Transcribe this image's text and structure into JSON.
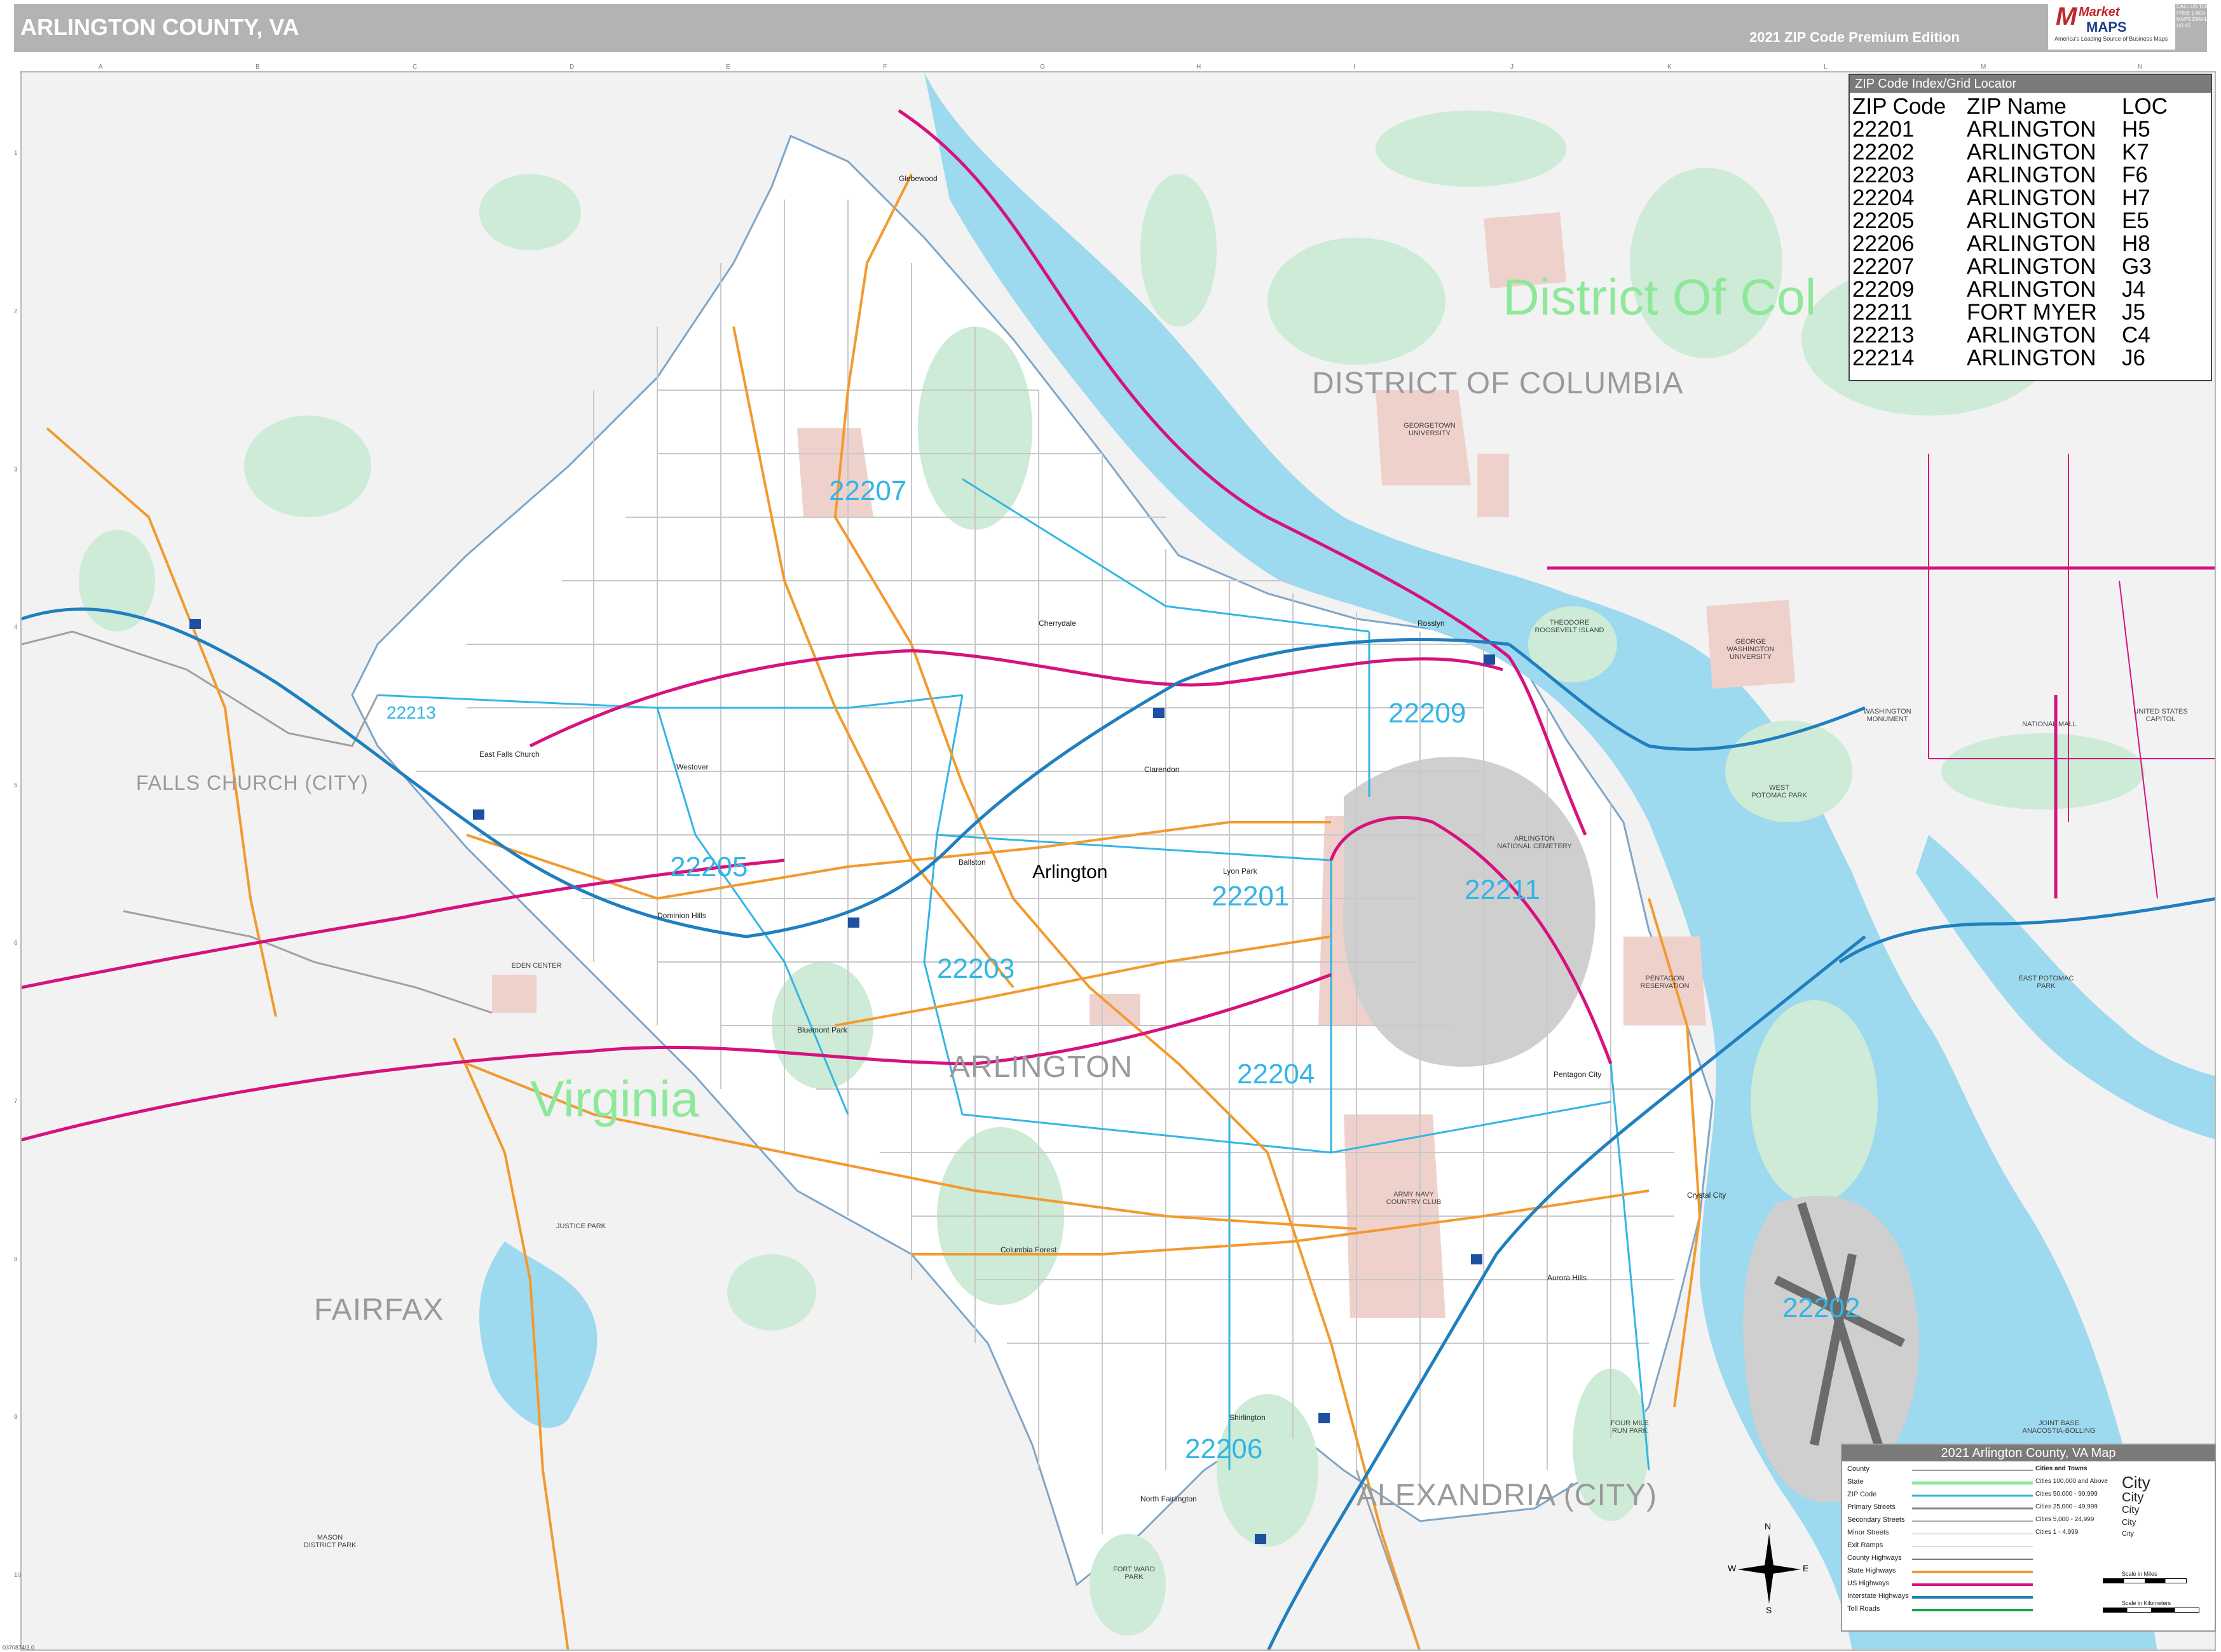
{
  "header": {
    "title": "ARLINGTON COUNTY, VA",
    "edition": "2021 ZIP Code Premium Edition",
    "logo_text_1": "Market",
    "logo_text_2": "MAPS",
    "logo_slogan": "America's Leading Source of Business Maps",
    "logo_contact": "CALL US TOLL FREE 1-800-MAPS EMAIL US AT"
  },
  "grid": {
    "letters": [
      "A",
      "B",
      "C",
      "D",
      "E",
      "F",
      "G",
      "H",
      "I",
      "J",
      "K",
      "L",
      "M",
      "N"
    ],
    "numbers": [
      "1",
      "2",
      "3",
      "4",
      "5",
      "6",
      "7",
      "8",
      "9",
      "10"
    ]
  },
  "zip_index": {
    "title": "ZIP Code Index/Grid Locator",
    "headers": [
      "ZIP Code",
      "ZIP Name",
      "LOC"
    ],
    "rows": [
      [
        "22201",
        "ARLINGTON",
        "H5"
      ],
      [
        "22202",
        "ARLINGTON",
        "K7"
      ],
      [
        "22203",
        "ARLINGTON",
        "F6"
      ],
      [
        "22204",
        "ARLINGTON",
        "H7"
      ],
      [
        "22205",
        "ARLINGTON",
        "E5"
      ],
      [
        "22206",
        "ARLINGTON",
        "H8"
      ],
      [
        "22207",
        "ARLINGTON",
        "G3"
      ],
      [
        "22209",
        "ARLINGTON",
        "J4"
      ],
      [
        "22211",
        "FORT MYER",
        "J5"
      ],
      [
        "22213",
        "ARLINGTON",
        "C4"
      ],
      [
        "22214",
        "ARLINGTON",
        "J6"
      ]
    ]
  },
  "map_labels": {
    "zip_22207": "22207",
    "zip_22209": "22209",
    "zip_22213": "22213",
    "zip_22205": "22205",
    "zip_22201": "22201",
    "zip_22211": "22211",
    "zip_22203": "22203",
    "zip_22204": "22204",
    "zip_22202": "22202",
    "zip_22206": "22206",
    "city_arlington": "Arlington",
    "region_dc": "DISTRICT OF COLUMBIA",
    "region_falls_church": "FALLS CHURCH (CITY)",
    "region_arlington": "ARLINGTON",
    "region_fairfax": "FAIRFAX",
    "region_alexandria": "ALEXANDRIA (CITY)",
    "state_virginia": "Virginia",
    "state_dc": "District Of Col",
    "place_rosslyn": "Rosslyn",
    "place_clarendon": "Clarendon",
    "place_ballston": "Ballston",
    "place_columbia_pike": "Columbia Forest",
    "place_shirlington": "Shirlington",
    "place_crystal_city": "Crystal City",
    "place_pentagon": "Pentagon City",
    "place_east_falls_church": "East Falls Church",
    "place_westover": "Westover",
    "place_cherrydale": "Cherrydale",
    "place_lyon_park": "Lyon Park",
    "place_aurora": "Aurora Hills",
    "place_fairlington": "North Fairlington",
    "place_glebe": "Glebewood",
    "place_dominion": "Dominion Hills",
    "place_bluemont": "Bluemont Park",
    "park_arlington_cemetery": "ARLINGTON NATIONAL CEMETERY",
    "park_pentagon_reservation": "PENTAGON RESERVATION",
    "park_army_navy": "ARMY NAVY COUNTRY CLUB",
    "park_roosevelt": "THEODORE ROOSEVELT ISLAND",
    "park_georgetown": "GEORGETOWN UNIVERSITY",
    "park_gwu": "GEORGE WASHINGTON UNIVERSITY",
    "park_west_potomac": "WEST POTOMAC PARK",
    "park_east_potomac": "EAST POTOMAC PARK",
    "park_national_mall": "NATIONAL MALL",
    "park_washington_monument": "WASHINGTON MONUMENT",
    "park_eden": "EDEN CENTER",
    "park_justice": "JUSTICE PARK",
    "park_mason": "MASON DISTRICT PARK",
    "park_four_mile": "FOUR MILE RUN PARK",
    "park_fort_ward": "FORT WARD PARK",
    "park_bolling": "JOINT BASE ANACOSTIA-BOLLING",
    "park_us_capitol": "UNITED STATES CAPITOL"
  },
  "legend": {
    "title": "2021 Arlington County, VA Map",
    "rows": [
      "County",
      "State",
      "ZIP Code",
      "Primary Streets",
      "Secondary Streets",
      "Minor Streets",
      "Exit Ramps",
      "County Highways",
      "State Highways",
      "US Highways",
      "Interstate Highways",
      "Toll Roads"
    ],
    "cities_title": "Cities and Towns",
    "cities": [
      "Cities 100,000 and Above",
      "Cities 50,000 - 99,999",
      "Cities 25,000 - 49,999",
      "Cities 5,000 - 24,999",
      "Cities 1 - 4,999"
    ],
    "city_samples": [
      "City",
      "City",
      "City",
      "City",
      "City"
    ],
    "scale_miles": "Scale in Miles",
    "scale_km": "Scale in Kilometers"
  },
  "compass": {
    "n": "N",
    "s": "S",
    "e": "E",
    "w": "W"
  },
  "footer": {
    "code": "0370874/3.0"
  },
  "colors": {
    "water": "#9dd9ef",
    "park": "#cdebd6",
    "institution": "#efd1cc",
    "military": "#cfcfcf",
    "zip_line": "#33b5e5",
    "interstate": "#1f7fbf",
    "us_highway": "#d6127f",
    "state_highway": "#f29a2e",
    "county_line": "#7ea6c9"
  }
}
